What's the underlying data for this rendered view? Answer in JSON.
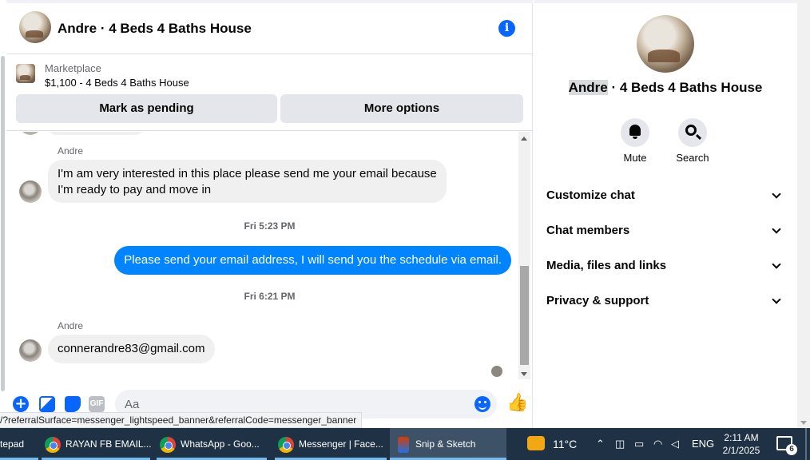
{
  "header": {
    "title": "Andre · 4 Beds 4 Baths House"
  },
  "marketplace": {
    "label": "Marketplace",
    "listing": "$1,100 - 4 Beds 4 Baths House",
    "mark_pending": "Mark as pending",
    "more_options": "More options"
  },
  "messages": {
    "m1_sender": "Andre",
    "m1_text": "I'm am very interested in this place please send me your email because I'm ready to pay and move in",
    "ts1": "Fri 5:23 PM",
    "m2_text": "Please send your email address, I will send you the schedule via email.",
    "ts2": "Fri 6:21 PM",
    "m3_sender": "Andre",
    "m3_text": "connerandre83@gmail.com"
  },
  "composer": {
    "placeholder": "Aa",
    "gif_label": "GIF"
  },
  "status_url": "/?referralSurface=messenger_lightspeed_banner&referralCode=messenger_banner",
  "sidebar": {
    "name_highlight": "Andre",
    "name_rest": " · 4 Beds 4 Baths House",
    "mute": "Mute",
    "search": "Search",
    "sections": [
      "Customize chat",
      "Chat members",
      "Media, files and links",
      "Privacy & support"
    ]
  },
  "taskbar": {
    "items": [
      "tepad",
      "RAYAN FB EMAIL...",
      "WhatsApp - Goo...",
      "Messenger | Face...",
      "Snip & Sketch"
    ],
    "temperature": "11°C",
    "language": "ENG",
    "time": "2:11 AM",
    "date": "2/1/2025",
    "notification_count": "6"
  },
  "colors": {
    "accent": "#0866ff",
    "outgoing_bubble": "#0084ff",
    "incoming_bubble": "#f0f0f0",
    "taskbar": "#1f3245"
  }
}
